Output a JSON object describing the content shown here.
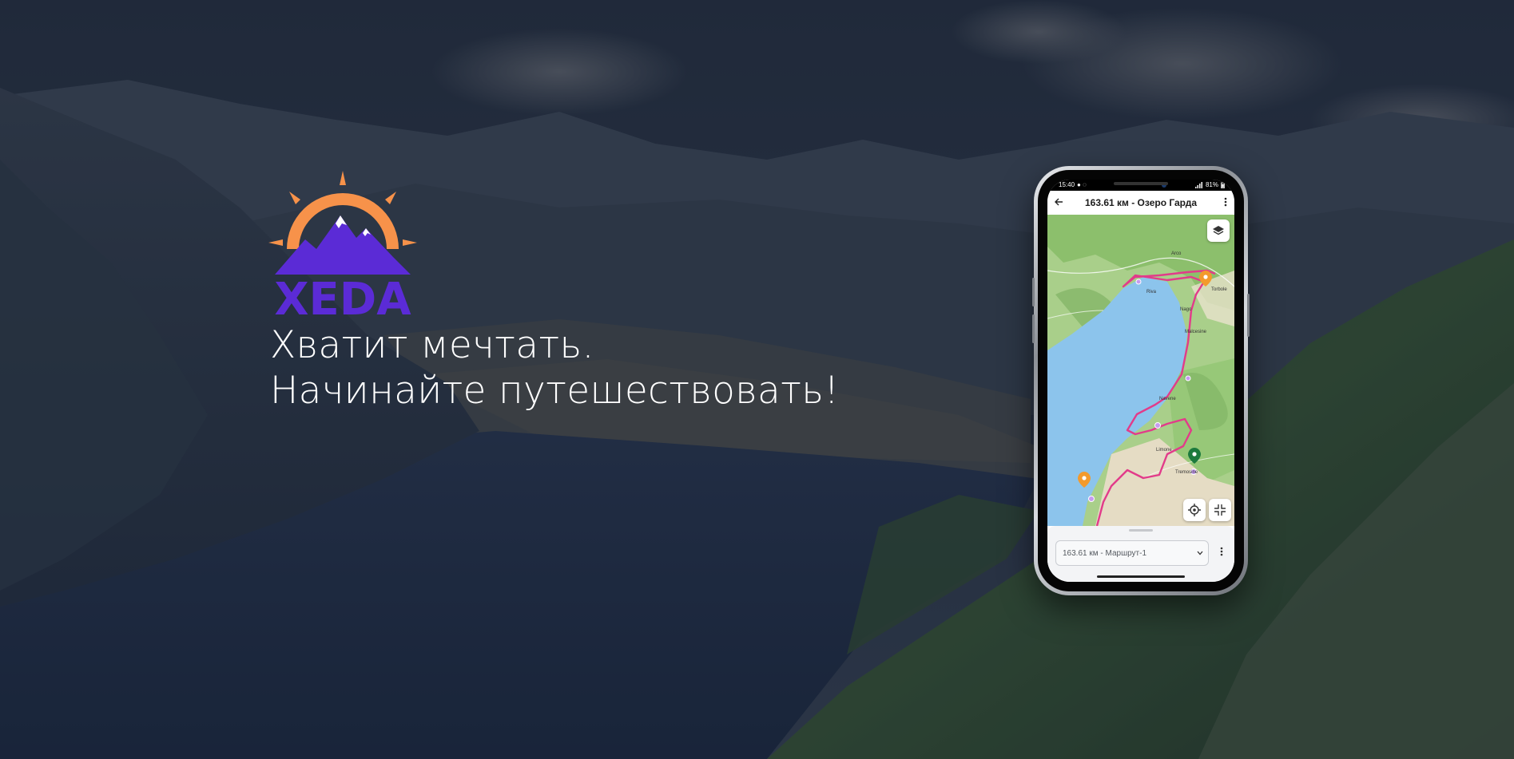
{
  "brand": {
    "name": "XEDA",
    "colors": {
      "sun": "#f7924a",
      "mountain": "#5b2bd6"
    }
  },
  "hero": {
    "headline_line1": "Хватит мечтать.",
    "headline_line2": "Начинайте путешествовать!"
  },
  "phone": {
    "status": {
      "time": "15:40",
      "battery": "81%"
    },
    "appbar": {
      "back_icon": "arrow-left-icon",
      "title": "163.61 км - Озеро Гарда",
      "menu_icon": "more-vertical-icon"
    },
    "map": {
      "buttons": [
        "layers-icon",
        "locate-icon",
        "collapse-icon"
      ],
      "labels": {
        "arco": "Arco",
        "torbole": "Torbole",
        "nago": "Nago",
        "riva": "Riva",
        "malcesine": "Malcesine",
        "navene": "Navene",
        "tremosine": "Tremosine",
        "limone": "Limone"
      },
      "route_color": "#e23b8a",
      "water_color": "#8cc4ec"
    },
    "route_select": {
      "value": "163.61 км - Маршрут-1",
      "chevron_icon": "chevron-down-icon",
      "menu_icon": "more-vertical-icon"
    }
  }
}
